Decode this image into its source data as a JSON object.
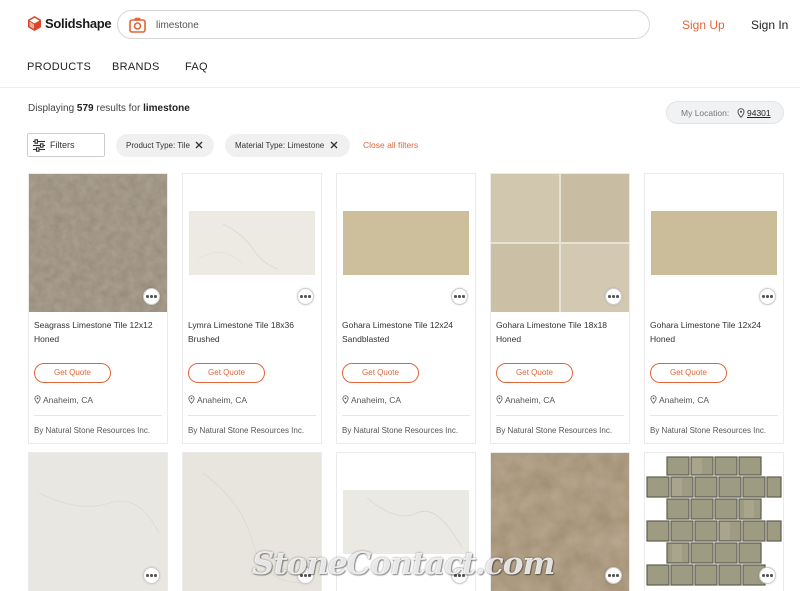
{
  "header": {
    "logo_text": "Solidshape",
    "search_value": "limestone",
    "signup": "Sign Up",
    "signin": "Sign In"
  },
  "nav": {
    "products": "PRODUCTS",
    "brands": "BRANDS",
    "faq": "FAQ"
  },
  "results": {
    "prefix": "Displaying",
    "count": "579",
    "middle": "results for",
    "query": "limestone"
  },
  "location": {
    "label": "My Location:",
    "zip": "94301"
  },
  "filters": {
    "button": "Filters",
    "chips": [
      "Product Type: Tile",
      "Material Type: Limestone"
    ],
    "clear": "Close all filters"
  },
  "cards": [
    {
      "title": "Seagrass Limestone Tile 12x12 Honed",
      "quote": "Get Quote",
      "location": "Anaheim, CA",
      "by": "By Natural Stone Resources Inc."
    },
    {
      "title": "Lymra Limestone Tile 18x36 Brushed",
      "quote": "Get Quote",
      "location": "Anaheim, CA",
      "by": "By Natural Stone Resources Inc."
    },
    {
      "title": "Gohara Limestone Tile 12x24 Sandblasted",
      "quote": "Get Quote",
      "location": "Anaheim, CA",
      "by": "By Natural Stone Resources Inc."
    },
    {
      "title": "Gohara Limestone Tile 18x18 Honed",
      "quote": "Get Quote",
      "location": "Anaheim, CA",
      "by": "By Natural Stone Resources Inc."
    },
    {
      "title": "Gohara Limestone Tile 12x24 Honed",
      "quote": "Get Quote",
      "location": "Anaheim, CA",
      "by": "By Natural Stone Resources Inc."
    }
  ],
  "watermark": "StoneContact.com",
  "colors": {
    "accent": "#e0663a",
    "text": "#222222",
    "chip_bg": "#f0f0f0"
  }
}
